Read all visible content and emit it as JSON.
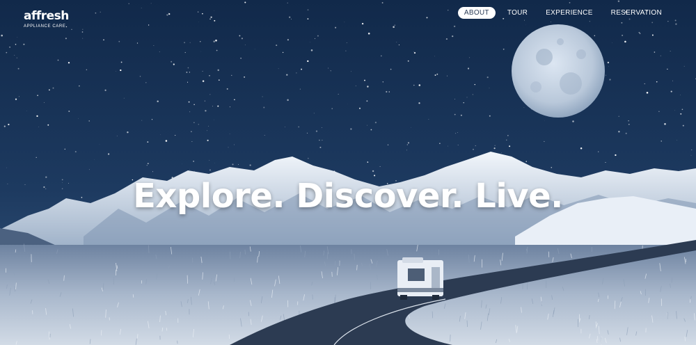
{
  "brand": {
    "name": "affresh",
    "tagline": "APPLIANCE CARE"
  },
  "nav": {
    "items": [
      {
        "label": "ABOUT",
        "active": true
      },
      {
        "label": "TOUR",
        "active": false
      },
      {
        "label": "EXPERIENCE",
        "active": false
      },
      {
        "label": "RESERVATION",
        "active": false
      }
    ]
  },
  "hero": {
    "headline": "Explore. Discover. Live."
  },
  "colors": {
    "sky_top": "#132a47",
    "sky_bottom": "#2c4d72",
    "snow": "#e6eef8",
    "road": "#2a3a50",
    "grass": "#c9d3e0"
  }
}
